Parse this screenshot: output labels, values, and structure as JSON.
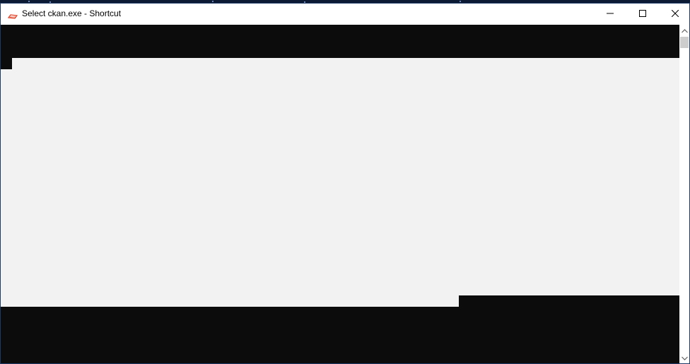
{
  "window": {
    "title": "Select ckan.exe - Shortcut",
    "icon": "ckan-app-icon",
    "controls": {
      "minimize_icon": "minimize-icon",
      "maximize_icon": "maximize-icon",
      "close_icon": "close-icon"
    }
  },
  "colors": {
    "console_background": "#0c0c0c",
    "selection_highlight": "#f2f2f2",
    "titlebar": "#ffffff",
    "scroll_thumb": "#cdcdcd",
    "icon_accent": "#e03a1e"
  },
  "scrollbar": {
    "up_icon": "chevron-up-icon",
    "down_icon": "chevron-down-icon"
  }
}
